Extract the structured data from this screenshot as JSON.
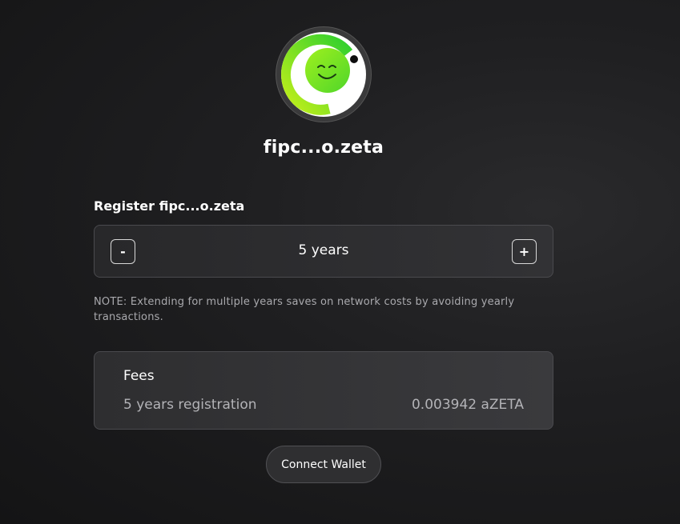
{
  "profile": {
    "avatar_icon": "smiling-green-blob-icon",
    "domain_name": "fipc...o.zeta"
  },
  "register": {
    "label": "Register fipc...o.zeta",
    "minus_label": "-",
    "plus_label": "+",
    "duration_value": "5 years",
    "note": "NOTE: Extending for multiple years saves on network costs by avoiding yearly transactions."
  },
  "fees": {
    "title": "Fees",
    "row_label": "5 years registration",
    "row_value": "0.003942 aZETA"
  },
  "actions": {
    "connect_wallet_label": "Connect Wallet"
  },
  "colors": {
    "background": "#1f1f21",
    "accent_green": "#8fe61d",
    "text_primary": "#ffffff",
    "text_muted": "#a9a9ad"
  }
}
